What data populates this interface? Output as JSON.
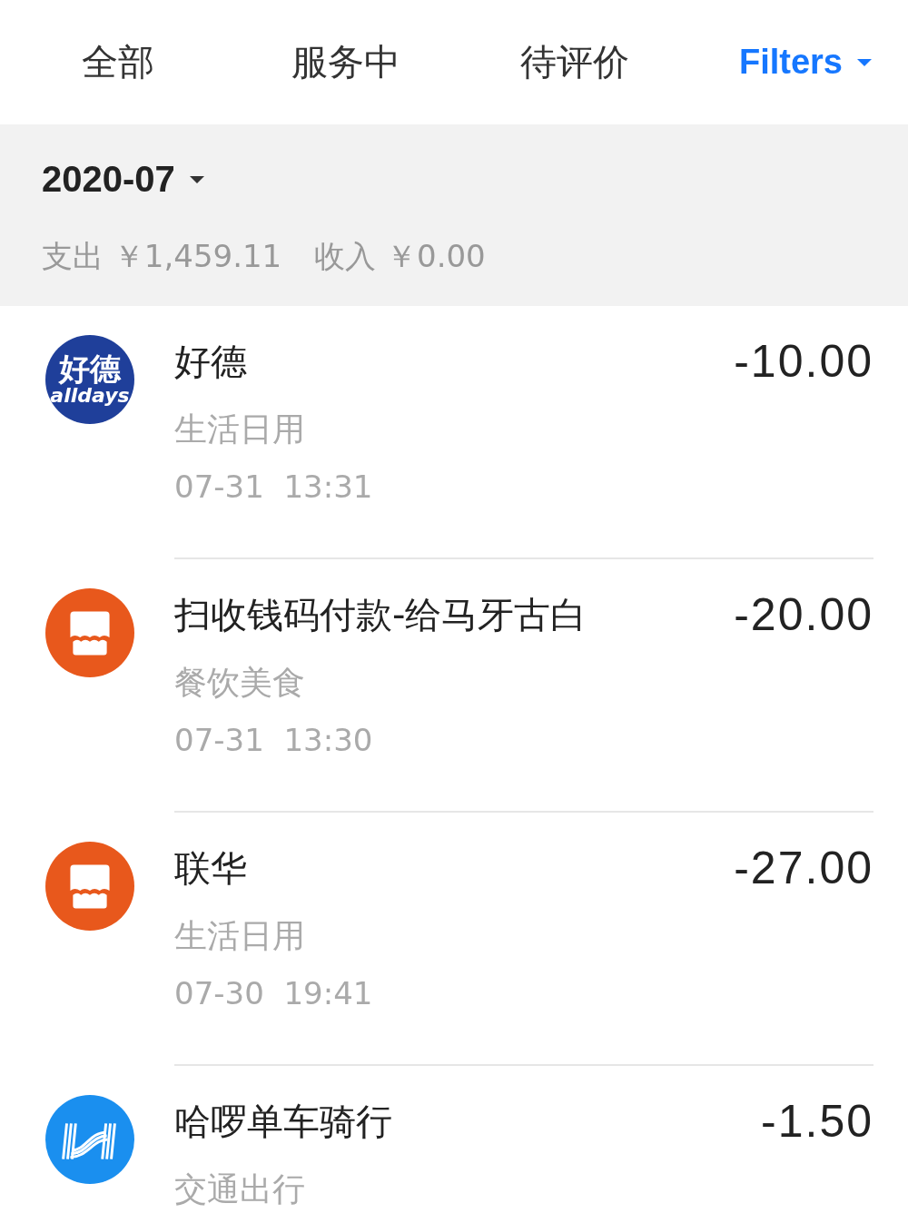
{
  "tabs": [
    {
      "label": "全部"
    },
    {
      "label": "服务中"
    },
    {
      "label": "待评价"
    }
  ],
  "filters": {
    "label": "Filters"
  },
  "month": {
    "label": "2020-07",
    "summary": "支出 ￥1,459.11",
    "income": "收入 ￥0.00"
  },
  "transactions": [
    {
      "icon": {
        "kind": "logo",
        "texts": [
          "好德",
          "alldays"
        ]
      },
      "title": "好德",
      "category": "生活日用",
      "date": "07-31",
      "time": "13:31",
      "amount": "-10.00"
    },
    {
      "icon": {
        "kind": "shop"
      },
      "title": "扫收钱码付款-给马牙古白",
      "category": "餐饮美食",
      "date": "07-31",
      "time": "13:30",
      "amount": "-20.00"
    },
    {
      "icon": {
        "kind": "shop"
      },
      "title": "联华",
      "category": "生活日用",
      "date": "07-30",
      "time": "19:41",
      "amount": "-27.00"
    },
    {
      "icon": {
        "kind": "bike"
      },
      "title": "哈啰单车骑行",
      "category": "交通出行",
      "amount": "-1.50"
    }
  ]
}
